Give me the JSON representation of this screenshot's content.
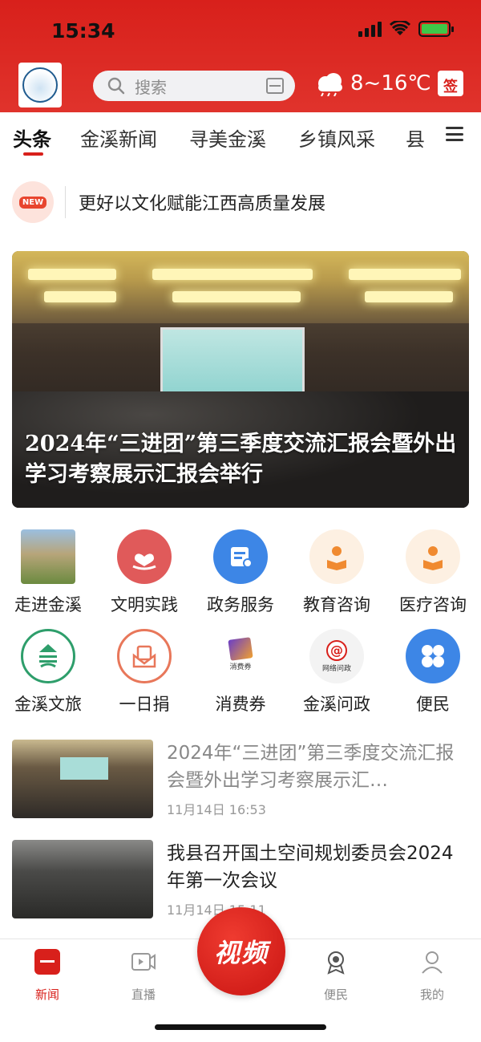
{
  "status_bar": {
    "time": "15:34"
  },
  "header": {
    "search_placeholder": "搜索",
    "weather": "8~16℃",
    "sign_label": "签"
  },
  "tabs": [
    {
      "label": "头条",
      "active": true
    },
    {
      "label": "金溪新闻",
      "active": false
    },
    {
      "label": "寻美金溪",
      "active": false
    },
    {
      "label": "乡镇风采",
      "active": false
    },
    {
      "label": "县",
      "active": false
    }
  ],
  "flash": {
    "badge": "NEW",
    "headline": "更好以文化赋能江西高质量发展"
  },
  "hero": {
    "caption": "2024年“三进团”第三季度交流汇报会暨外出学习考察展示汇报会举行"
  },
  "services": [
    {
      "label": "走进金溪",
      "icon": "town-photo-icon"
    },
    {
      "label": "文明实践",
      "icon": "heart-hand-icon"
    },
    {
      "label": "政务服务",
      "icon": "document-user-icon"
    },
    {
      "label": "教育咨询",
      "icon": "reading-person-icon"
    },
    {
      "label": "医疗咨询",
      "icon": "reading-person-icon"
    },
    {
      "label": "金溪文旅",
      "icon": "jinxi-logo-icon"
    },
    {
      "label": "一日捐",
      "icon": "envelope-icon"
    },
    {
      "label": "消费券",
      "icon": "coupon-icon",
      "sublabel": "消费券"
    },
    {
      "label": "金溪问政",
      "icon": "network-inquiry-icon",
      "sublabel": "网络问政"
    },
    {
      "label": "便民",
      "icon": "four-petal-icon"
    }
  ],
  "news": [
    {
      "title": "2024年“三进团”第三季度交流汇报会暨外出学习考察展示汇…",
      "time": "11月14日  16:53"
    },
    {
      "title": "我县召开国土空间规划委员会2024年第一次会议",
      "time": "11月14日  15:11"
    }
  ],
  "bottom_nav": [
    {
      "label": "新闻",
      "icon": "news-icon",
      "active": true
    },
    {
      "label": "直播",
      "icon": "live-icon",
      "active": false
    },
    {
      "label": "视频",
      "icon": "video-icon",
      "active": false
    },
    {
      "label": "便民",
      "icon": "badge-icon",
      "active": false
    },
    {
      "label": "我的",
      "icon": "profile-icon",
      "active": false
    }
  ],
  "colors": {
    "brand_red": "#d8201b",
    "accent_blue": "#3d86e6",
    "accent_orange": "#f08a30"
  }
}
